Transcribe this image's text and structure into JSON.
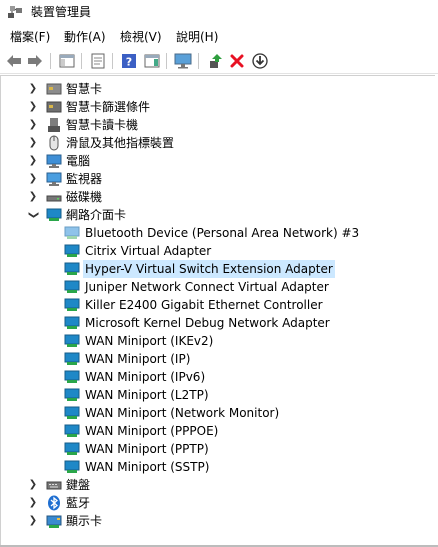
{
  "window": {
    "title": "裝置管理員"
  },
  "menu": [
    "檔案(F)",
    "動作(A)",
    "檢視(V)",
    "說明(H)"
  ],
  "toolbar": {
    "icons": [
      "back-arrow-icon",
      "forward-arrow-icon",
      "show-hide-console-tree-icon",
      "properties-icon",
      "help-icon",
      "action-pane-icon",
      "monitor-icon",
      "update-driver-icon",
      "uninstall-device-icon",
      "download-icon"
    ]
  },
  "tree": {
    "categories_top": [
      {
        "label": "智慧卡",
        "icon": "smart-card-icon"
      },
      {
        "label": "智慧卡篩選條件",
        "icon": "smart-card-filter-icon"
      },
      {
        "label": "智慧卡讀卡機",
        "icon": "smart-card-reader-icon"
      },
      {
        "label": "滑鼠及其他指標裝置",
        "icon": "mouse-icon"
      },
      {
        "label": "電腦",
        "icon": "computer-icon"
      },
      {
        "label": "監視器",
        "icon": "monitor-icon"
      },
      {
        "label": "磁碟機",
        "icon": "disk-drive-icon"
      }
    ],
    "network": {
      "label": "網路介面卡",
      "selected": "Hyper-V Virtual Switch Extension Adapter",
      "children": [
        "Bluetooth Device (Personal Area Network) #3",
        "Citrix Virtual Adapter",
        "Hyper-V Virtual Switch Extension Adapter",
        "Juniper Network Connect Virtual Adapter",
        "Killer E2400 Gigabit Ethernet Controller",
        "Microsoft Kernel Debug Network Adapter",
        "WAN Miniport (IKEv2)",
        "WAN Miniport (IP)",
        "WAN Miniport (IPv6)",
        "WAN Miniport (L2TP)",
        "WAN Miniport (Network Monitor)",
        "WAN Miniport (PPPOE)",
        "WAN Miniport (PPTP)",
        "WAN Miniport (SSTP)"
      ]
    },
    "categories_bottom": [
      {
        "label": "鍵盤",
        "icon": "keyboard-icon"
      },
      {
        "label": "藍牙",
        "icon": "bluetooth-icon"
      },
      {
        "label": "顯示卡",
        "icon": "display-adapter-icon"
      }
    ]
  },
  "colors": {
    "selection": "#cce8ff",
    "network_icon": "#1e88c7",
    "uninstall": "#e81123"
  }
}
